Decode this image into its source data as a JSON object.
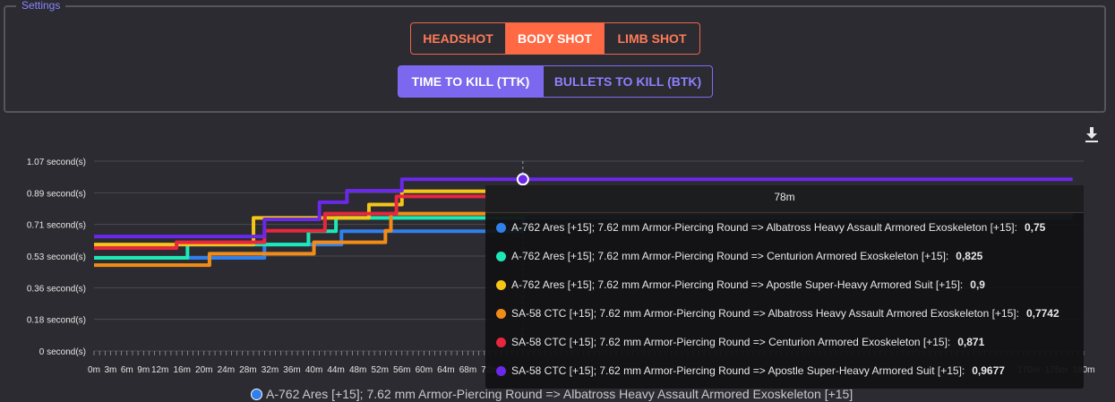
{
  "settings": {
    "legend": "Settings"
  },
  "shot_buttons": [
    {
      "label": "HEADSHOT",
      "active": false
    },
    {
      "label": "BODY SHOT",
      "active": true
    },
    {
      "label": "LIMB SHOT",
      "active": false
    }
  ],
  "mode_buttons": [
    {
      "label": "TIME TO KILL (TTK)",
      "active": true
    },
    {
      "label": "BULLETS TO KILL (BTK)",
      "active": false
    }
  ],
  "download_icon": "download-icon",
  "tooltip": {
    "header": "78m",
    "rows": [
      {
        "label": "A-762 Ares [+15]; 7.62 mm Armor-Piercing Round => Albatross Heavy Assault Armored Exoskeleton [+15]:",
        "value": "0,75",
        "color": "#2f80ed"
      },
      {
        "label": "A-762 Ares [+15]; 7.62 mm Armor-Piercing Round => Centurion Armored Exoskeleton [+15]:",
        "value": "0,825",
        "color": "#1de9b6"
      },
      {
        "label": "A-762 Ares [+15]; 7.62 mm Armor-Piercing Round => Apostle Super-Heavy Armored Suit [+15]:",
        "value": "0,9",
        "color": "#f5c518"
      },
      {
        "label": "SA-58 CTC [+15]; 7.62 mm Armor-Piercing Round => Albatross Heavy Assault Armored Exoskeleton [+15]:",
        "value": "0,7742",
        "color": "#f28c18"
      },
      {
        "label": "SA-58 CTC [+15]; 7.62 mm Armor-Piercing Round => Centurion Armored Exoskeleton [+15]:",
        "value": "0,871",
        "color": "#e8273f"
      },
      {
        "label": "SA-58 CTC [+15]; 7.62 mm Armor-Piercing Round => Apostle Super-Heavy Armored Suit [+15]:",
        "value": "0,9677",
        "color": "#6a28e8"
      }
    ]
  },
  "legend": {
    "label": "A-762 Ares [+15]; 7.62 mm Armor-Piercing Round => Albatross Heavy Assault Armored Exoskeleton [+15]",
    "color": "#2f80ed"
  },
  "chart_data": {
    "type": "line",
    "step": true,
    "yticks": [
      "0 second(s)",
      "0.18 second(s)",
      "0.36 second(s)",
      "0.53 second(s)",
      "0.71 second(s)",
      "0.89 second(s)",
      "1.07 second(s)"
    ],
    "ylim": [
      0,
      1.07
    ],
    "xlim": [
      0,
      180
    ],
    "xticks_visible": [
      "0m",
      "3m",
      "6m",
      "9m",
      "12m",
      "16m",
      "20m",
      "24m",
      "28m",
      "32m",
      "36m",
      "40m",
      "44m",
      "48m",
      "52m",
      "56m",
      "60m",
      "64m",
      "68m",
      "72m",
      "170m",
      "175m",
      "180m"
    ],
    "crosshair_x": 78,
    "grid": true,
    "series": [
      {
        "name": "A-762 Ares [+15]; 7.62 mm Armor-Piercing Round => Albatross Heavy Assault Armored Exoskeleton [+15]",
        "color": "#2f80ed",
        "steps": [
          [
            0,
            0.525
          ],
          [
            31,
            0.6
          ],
          [
            45,
            0.675
          ],
          [
            78,
            0.75
          ]
        ]
      },
      {
        "name": "A-762 Ares [+15]; 7.62 mm Armor-Piercing Round => Centurion Armored Exoskeleton [+15]",
        "color": "#1de9b6",
        "steps": [
          [
            0,
            0.525
          ],
          [
            17,
            0.6
          ],
          [
            39,
            0.675
          ],
          [
            44,
            0.75
          ],
          [
            78,
            0.825
          ]
        ]
      },
      {
        "name": "A-762 Ares [+15]; 7.62 mm Armor-Piercing Round => Apostle Super-Heavy Armored Suit [+15]",
        "color": "#f5c518",
        "steps": [
          [
            0,
            0.6
          ],
          [
            29,
            0.75
          ],
          [
            50,
            0.825
          ],
          [
            56,
            0.9
          ]
        ]
      },
      {
        "name": "SA-58 CTC [+15]; 7.62 mm Armor-Piercing Round => Albatross Heavy Assault Armored Exoskeleton [+15]",
        "color": "#f28c18",
        "steps": [
          [
            0,
            0.4839
          ],
          [
            21,
            0.5484
          ],
          [
            40,
            0.6129
          ],
          [
            53,
            0.6774
          ],
          [
            54,
            0.7742
          ]
        ]
      },
      {
        "name": "SA-58 CTC [+15]; 7.62 mm Armor-Piercing Round => Centurion Armored Exoskeleton [+15]",
        "color": "#e8273f",
        "steps": [
          [
            0,
            0.5806
          ],
          [
            15,
            0.6129
          ],
          [
            31,
            0.6774
          ],
          [
            42,
            0.7742
          ],
          [
            55,
            0.871
          ]
        ]
      },
      {
        "name": "SA-58 CTC [+15]; 7.62 mm Armor-Piercing Round => Apostle Super-Heavy Armored Suit [+15]",
        "color": "#6a28e8",
        "steps": [
          [
            0,
            0.6452
          ],
          [
            31,
            0.7419
          ],
          [
            41,
            0.8387
          ],
          [
            46,
            0.9032
          ],
          [
            56,
            0.9677
          ]
        ]
      }
    ]
  }
}
